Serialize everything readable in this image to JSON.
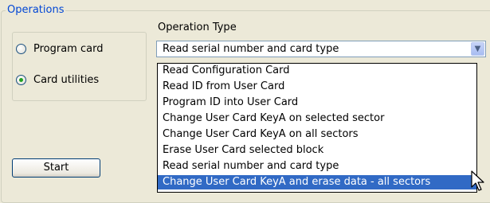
{
  "groupbox": {
    "title": "Operations"
  },
  "radios": [
    {
      "label": "Program card",
      "checked": false
    },
    {
      "label": "Card utilities",
      "checked": true
    }
  ],
  "operation_type": {
    "label": "Operation Type",
    "selected_value": "Read serial number and card type"
  },
  "dropdown": {
    "items": [
      "Read Configuration Card",
      "Read ID from User Card",
      "Program ID into User Card",
      "Change User Card KeyA on selected sector",
      "Change User Card KeyA on all sectors",
      "Erase User Card selected block",
      "Read serial number and card type",
      "Change User Card KeyA and erase data - all sectors"
    ],
    "highlighted_index": 7
  },
  "start_button": {
    "label": "Start"
  },
  "icons": {
    "combo_arrow": "chevron-down-icon",
    "cursor": "mouse-pointer-icon"
  },
  "colors": {
    "highlight": "#316ac5",
    "group_title": "#0046d5",
    "radio_dot": "#21a121"
  }
}
